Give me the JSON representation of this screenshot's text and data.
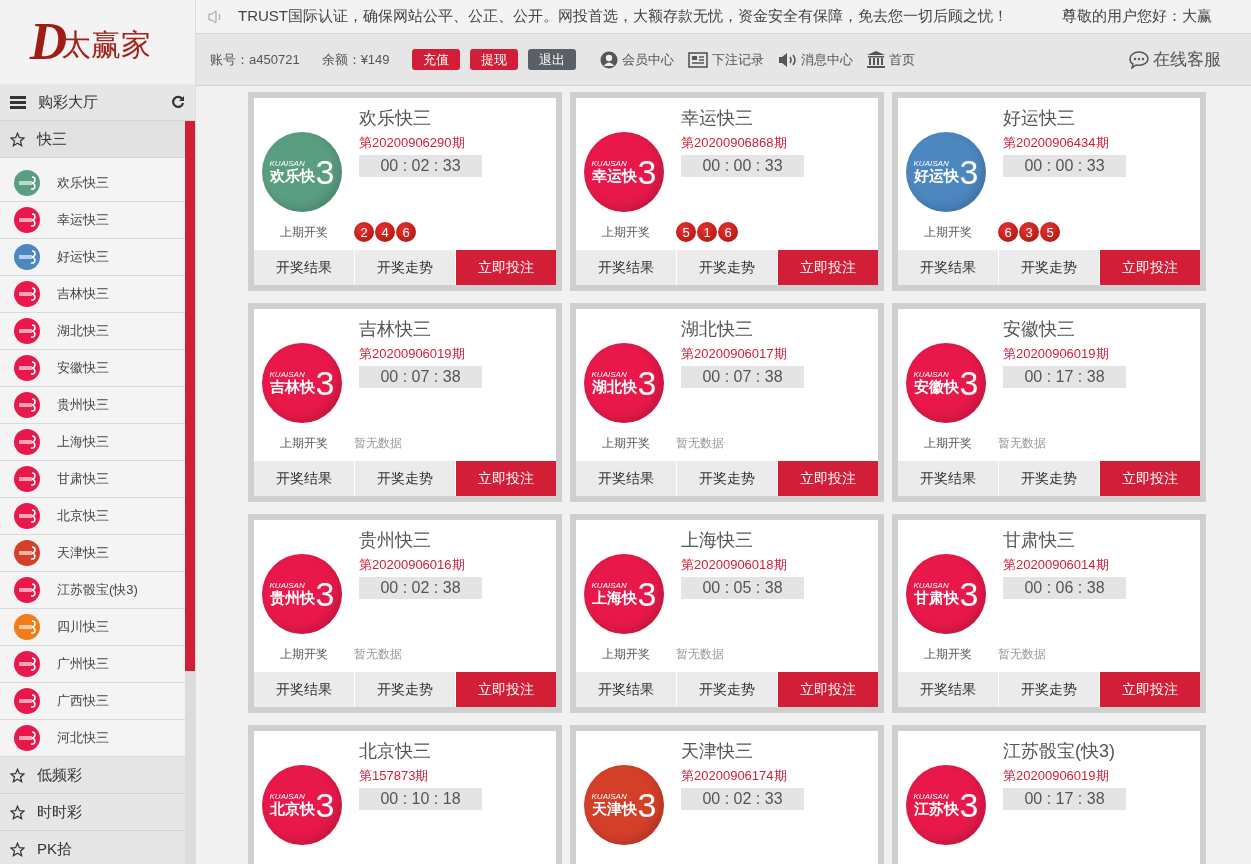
{
  "brand": {
    "letter": "D",
    "name": "太赢家"
  },
  "notice": {
    "text": "TRUST国际认证，确保网站公平、公正、公开。网投首选，大额存款无忧，资金安全有保障，免去您一切后顾之忧！",
    "greeting": "尊敬的用户您好：大赢"
  },
  "account": {
    "user": "账号：a450721",
    "balance": "余额：¥149"
  },
  "actions": [
    {
      "label": "充值",
      "kind": "primary"
    },
    {
      "label": "提现",
      "kind": "primary"
    },
    {
      "label": "退出",
      "kind": "dark"
    }
  ],
  "nav": [
    {
      "label": "会员中心",
      "kind": "user"
    },
    {
      "label": "下注记录",
      "kind": "record"
    },
    {
      "label": "消息中心",
      "kind": "speaker"
    },
    {
      "label": "首页",
      "kind": "bank"
    }
  ],
  "service": "在线客服",
  "sidebar": {
    "title": "购彩大厅",
    "groups": [
      {
        "label": "快三",
        "expanded": true,
        "items": [
          {
            "label": "欢乐快三",
            "color": "#5a9e82"
          },
          {
            "label": "幸运快三",
            "color": "#e8194a"
          },
          {
            "label": "好运快三",
            "color": "#4d87c0"
          },
          {
            "label": "吉林快三",
            "color": "#e8194a"
          },
          {
            "label": "湖北快三",
            "color": "#e8194a"
          },
          {
            "label": "安徽快三",
            "color": "#e8194a"
          },
          {
            "label": "贵州快三",
            "color": "#e8194a"
          },
          {
            "label": "上海快三",
            "color": "#e8194a"
          },
          {
            "label": "甘肃快三",
            "color": "#e8194a"
          },
          {
            "label": "北京快三",
            "color": "#e8194a"
          },
          {
            "label": "天津快三",
            "color": "#d43f2a"
          },
          {
            "label": "江苏骰宝(快3)",
            "color": "#e8194a"
          },
          {
            "label": "四川快三",
            "color": "#f07d1a"
          },
          {
            "label": "广州快三",
            "color": "#e8194a"
          },
          {
            "label": "广西快三",
            "color": "#e8194a"
          },
          {
            "label": "河北快三",
            "color": "#e8194a"
          }
        ]
      },
      {
        "label": "低频彩",
        "expanded": false
      },
      {
        "label": "时时彩",
        "expanded": false
      },
      {
        "label": "PK拾",
        "expanded": false
      }
    ]
  },
  "cards": [
    {
      "name": "欢乐快三",
      "period": "第20200906290期",
      "timer": "00 : 02 : 33",
      "logo": {
        "latin": "KUAISAN",
        "name": "欢乐快",
        "digit": "3",
        "color": "#5a9e82"
      },
      "last_draw": {
        "label": "上期开奖",
        "balls": [
          "2",
          "4",
          "6"
        ]
      },
      "buttons": [
        {
          "label": "开奖结果",
          "kind": "plain"
        },
        {
          "label": "开奖走势",
          "kind": "plain"
        },
        {
          "label": "立即投注",
          "kind": "primary"
        }
      ]
    },
    {
      "name": "幸运快三",
      "period": "第20200906868期",
      "timer": "00 : 00 : 33",
      "logo": {
        "latin": "KUAISAN",
        "name": "幸运快",
        "digit": "3",
        "color": "#e8194a"
      },
      "last_draw": {
        "label": "上期开奖",
        "balls": [
          "5",
          "1",
          "6"
        ]
      },
      "buttons": [
        {
          "label": "开奖结果",
          "kind": "plain"
        },
        {
          "label": "开奖走势",
          "kind": "plain"
        },
        {
          "label": "立即投注",
          "kind": "primary"
        }
      ]
    },
    {
      "name": "好运快三",
      "period": "第20200906434期",
      "timer": "00 : 00 : 33",
      "logo": {
        "latin": "KUAISAN",
        "name": "好运快",
        "digit": "3",
        "color": "#4d87c0"
      },
      "last_draw": {
        "label": "上期开奖",
        "balls": [
          "6",
          "3",
          "5"
        ]
      },
      "buttons": [
        {
          "label": "开奖结果",
          "kind": "plain"
        },
        {
          "label": "开奖走势",
          "kind": "plain"
        },
        {
          "label": "立即投注",
          "kind": "primary"
        }
      ]
    },
    {
      "name": "吉林快三",
      "period": "第20200906019期",
      "timer": "00 : 07 : 38",
      "logo": {
        "latin": "KUAISAN",
        "name": "吉林快",
        "digit": "3",
        "color": "#e8194a"
      },
      "last_draw": {
        "label": "上期开奖",
        "empty_text": "暂无数据"
      },
      "buttons": [
        {
          "label": "开奖结果",
          "kind": "plain"
        },
        {
          "label": "开奖走势",
          "kind": "plain"
        },
        {
          "label": "立即投注",
          "kind": "primary"
        }
      ]
    },
    {
      "name": "湖北快三",
      "period": "第20200906017期",
      "timer": "00 : 07 : 38",
      "logo": {
        "latin": "KUAISAN",
        "name": "湖北快",
        "digit": "3",
        "color": "#e8194a"
      },
      "last_draw": {
        "label": "上期开奖",
        "empty_text": "暂无数据"
      },
      "buttons": [
        {
          "label": "开奖结果",
          "kind": "plain"
        },
        {
          "label": "开奖走势",
          "kind": "plain"
        },
        {
          "label": "立即投注",
          "kind": "primary"
        }
      ]
    },
    {
      "name": "安徽快三",
      "period": "第20200906019期",
      "timer": "00 : 17 : 38",
      "logo": {
        "latin": "KUAISAN",
        "name": "安徽快",
        "digit": "3",
        "color": "#e8194a"
      },
      "last_draw": {
        "label": "上期开奖",
        "empty_text": "暂无数据"
      },
      "buttons": [
        {
          "label": "开奖结果",
          "kind": "plain"
        },
        {
          "label": "开奖走势",
          "kind": "plain"
        },
        {
          "label": "立即投注",
          "kind": "primary"
        }
      ]
    },
    {
      "name": "贵州快三",
      "period": "第20200906016期",
      "timer": "00 : 02 : 38",
      "logo": {
        "latin": "KUAISAN",
        "name": "贵州快",
        "digit": "3",
        "color": "#e8194a"
      },
      "last_draw": {
        "label": "上期开奖",
        "empty_text": "暂无数据"
      },
      "buttons": [
        {
          "label": "开奖结果",
          "kind": "plain"
        },
        {
          "label": "开奖走势",
          "kind": "plain"
        },
        {
          "label": "立即投注",
          "kind": "primary"
        }
      ]
    },
    {
      "name": "上海快三",
      "period": "第20200906018期",
      "timer": "00 : 05 : 38",
      "logo": {
        "latin": "KUAISAN",
        "name": "上海快",
        "digit": "3",
        "color": "#e8194a"
      },
      "last_draw": {
        "label": "上期开奖",
        "empty_text": "暂无数据"
      },
      "buttons": [
        {
          "label": "开奖结果",
          "kind": "plain"
        },
        {
          "label": "开奖走势",
          "kind": "plain"
        },
        {
          "label": "立即投注",
          "kind": "primary"
        }
      ]
    },
    {
      "name": "甘肃快三",
      "period": "第20200906014期",
      "timer": "00 : 06 : 38",
      "logo": {
        "latin": "KUAISAN",
        "name": "甘肃快",
        "digit": "3",
        "color": "#e8194a"
      },
      "last_draw": {
        "label": "上期开奖",
        "empty_text": "暂无数据"
      },
      "buttons": [
        {
          "label": "开奖结果",
          "kind": "plain"
        },
        {
          "label": "开奖走势",
          "kind": "plain"
        },
        {
          "label": "立即投注",
          "kind": "primary"
        }
      ]
    },
    {
      "name": "北京快三",
      "period": "第157873期",
      "timer": "00 : 10 : 18",
      "logo": {
        "latin": "KUAISAN",
        "name": "北京快",
        "digit": "3",
        "color": "#e8194a"
      }
    },
    {
      "name": "天津快三",
      "period": "第20200906174期",
      "timer": "00 : 02 : 33",
      "logo": {
        "latin": "KUAISAN",
        "name": "天津快",
        "digit": "3",
        "color": "#d43f2a"
      }
    },
    {
      "name": "江苏骰宝(快3)",
      "period": "第20200906019期",
      "timer": "00 : 17 : 38",
      "logo": {
        "latin": "KUAISAN",
        "name": "江苏快",
        "digit": "3",
        "color": "#e8194a"
      }
    }
  ]
}
